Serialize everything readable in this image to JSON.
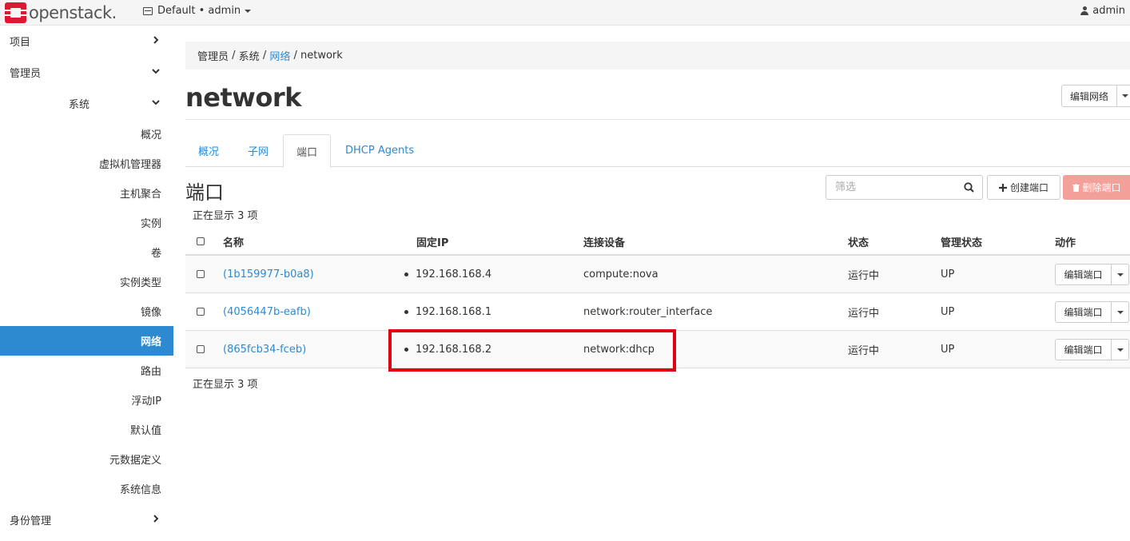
{
  "navbar": {
    "logo_text": "openstack.",
    "project_label": "Default • admin",
    "user_label": "admin"
  },
  "sidebar": {
    "project": "项目",
    "admin": "管理员",
    "system": "系统",
    "items": [
      "概况",
      "虚拟机管理器",
      "主机聚合",
      "实例",
      "卷",
      "实例类型",
      "镜像",
      "网络",
      "路由",
      "浮动IP",
      "默认值",
      "元数据定义",
      "系统信息"
    ],
    "identity": "身份管理"
  },
  "breadcrumb": [
    "管理员",
    "系统",
    "网络",
    "network"
  ],
  "page_title": "network",
  "edit_network_label": "编辑网络",
  "tabs": [
    "概况",
    "子网",
    "端口",
    "DHCP Agents"
  ],
  "section_title": "端口",
  "filter_placeholder": "筛选",
  "create_port_label": "创建端口",
  "delete_port_label": "删除端口",
  "count_text": "正在显示 3 项",
  "table": {
    "headers": [
      "名称",
      "固定IP",
      "连接设备",
      "状态",
      "管理状态",
      "动作"
    ],
    "rows": [
      {
        "name": "(1b159977-b0a8)",
        "ip": "192.168.168.4",
        "device": "compute:nova",
        "status": "运行中",
        "admin_state": "UP",
        "action": "编辑端口"
      },
      {
        "name": "(4056447b-eafb)",
        "ip": "192.168.168.1",
        "device": "network:router_interface",
        "status": "运行中",
        "admin_state": "UP",
        "action": "编辑端口"
      },
      {
        "name": "(865fcb34-fceb)",
        "ip": "192.168.168.2",
        "device": "network:dhcp",
        "status": "运行中",
        "admin_state": "UP",
        "action": "编辑端口"
      }
    ]
  },
  "colors": {
    "accent": "#2d8ad1",
    "danger_light": "#f4a09a",
    "highlight": "#e3000f",
    "logo_red": "#da1a32"
  }
}
